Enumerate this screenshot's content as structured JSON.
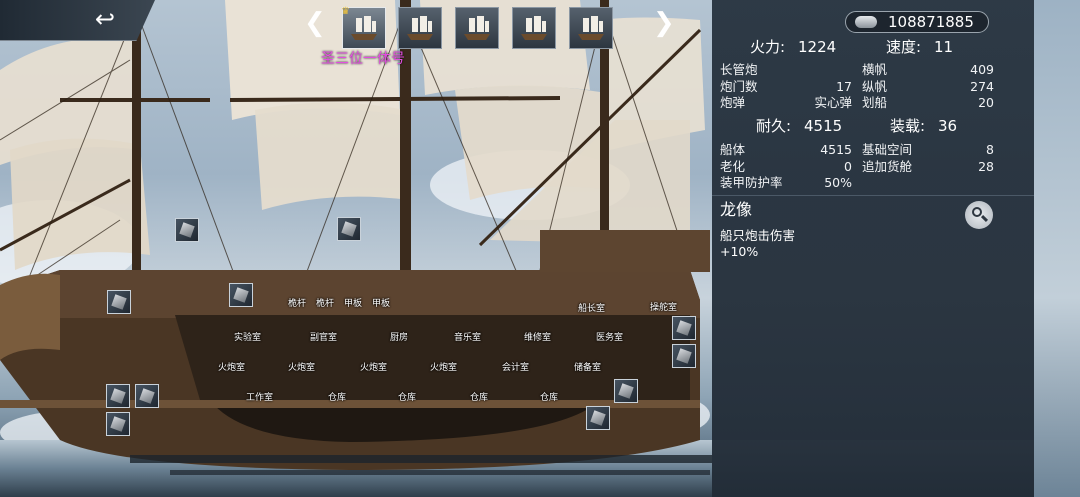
{
  "header": {
    "back_icon": "back-arrow-icon",
    "prev_icon": "chevron-left-icon",
    "next_icon": "chevron-right-icon",
    "ship_name": "圣三位一体号",
    "ship_slots": [
      "ship-1",
      "ship-2",
      "ship-3",
      "ship-4",
      "ship-5"
    ],
    "active_index": 0
  },
  "rooms": {
    "deck": [
      "桅杆",
      "桅杆",
      "甲板",
      "甲板",
      "船长室",
      "操舵室"
    ],
    "mid": [
      "实验室",
      "副官室",
      "厨房",
      "音乐室",
      "维修室",
      "医务室"
    ],
    "gun": [
      "火炮室",
      "火炮室",
      "火炮室",
      "火炮室",
      "会计室",
      "储备室"
    ],
    "hold": [
      "工作室",
      "仓库",
      "仓库",
      "仓库",
      "仓库"
    ]
  },
  "panel": {
    "currency": "108871885",
    "firepower_label": "火力:",
    "firepower": "1224",
    "speed_label": "速度:",
    "speed": "11",
    "cannon": [
      {
        "label": "长管炮",
        "value": ""
      },
      {
        "label": "炮门数",
        "value": "17"
      },
      {
        "label": "炮弹",
        "value": "实心弹"
      }
    ],
    "sail": [
      {
        "label": "横帆",
        "value": "409"
      },
      {
        "label": "纵帆",
        "value": "274"
      },
      {
        "label": "划船",
        "value": "20"
      }
    ],
    "durability_label": "耐久:",
    "durability": "4515",
    "capacity_label": "装载:",
    "capacity": "36",
    "hull": [
      {
        "label": "船体",
        "value": "4515"
      },
      {
        "label": "老化",
        "value": "0"
      },
      {
        "label": "装甲防护率",
        "value": "50%"
      }
    ],
    "space": [
      {
        "label": "基础空间",
        "value": "8"
      },
      {
        "label": "追加货舱",
        "value": "28"
      }
    ],
    "figurehead_title": "龙像",
    "figurehead_desc_1": "船只炮击伤害",
    "figurehead_desc_2": "+10%"
  },
  "colors": {
    "ship_name": "#e24fe0",
    "panel_bg": "#28343f"
  }
}
